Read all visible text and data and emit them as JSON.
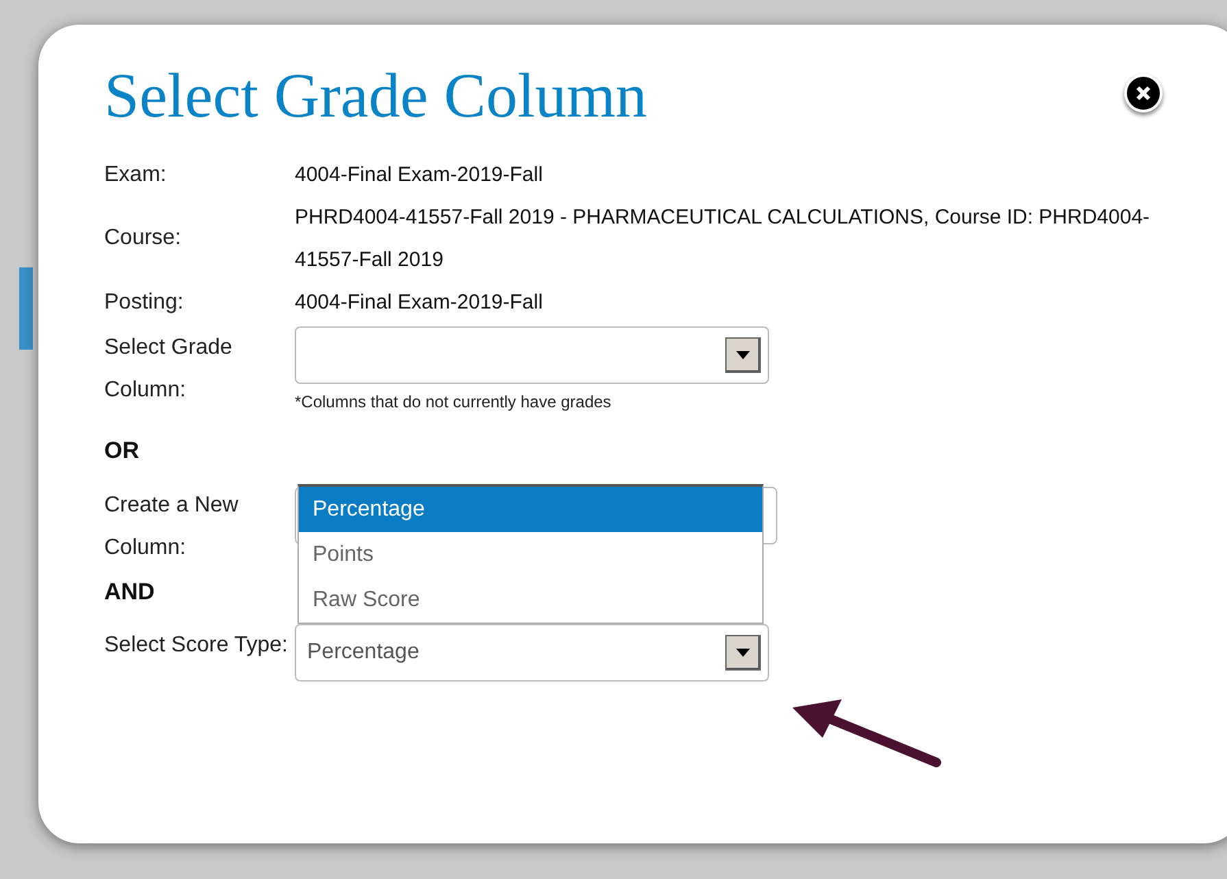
{
  "dialog": {
    "title": "Select Grade Column"
  },
  "info_rows": [
    {
      "label": "Exam:",
      "value": "4004-Final Exam-2019-Fall"
    },
    {
      "label": "Course:",
      "value": "PHRD4004-41557-Fall 2019 - PHARMACEUTICAL CALCULATIONS, Course ID: PHRD4004-41557-Fall 2019"
    },
    {
      "label": "Posting:",
      "value": "4004-Final Exam-2019-Fall"
    }
  ],
  "grade_column": {
    "label": "Select Grade Column:",
    "note": "*Columns that do not currently have grades"
  },
  "or_heading": "OR",
  "new_column": {
    "label": "Create a New Column:"
  },
  "and_heading": "AND",
  "score_type": {
    "label": "Select Score Type:",
    "value": "Percentage",
    "expanded": true,
    "options": [
      {
        "label": "Percentage",
        "selected": true
      },
      {
        "label": "Points",
        "selected": false
      },
      {
        "label": "Raw Score",
        "selected": false
      }
    ]
  }
}
